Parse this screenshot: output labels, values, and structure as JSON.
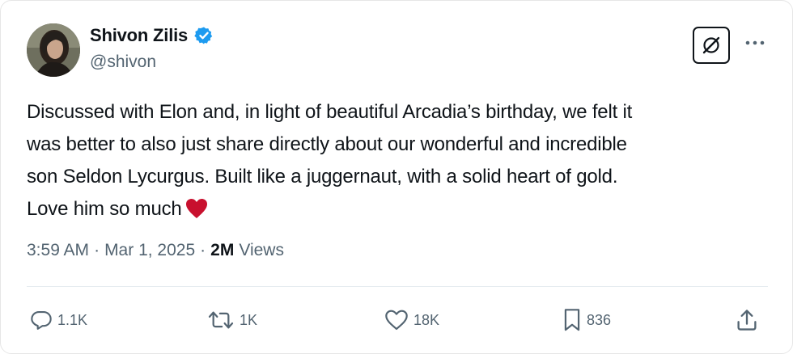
{
  "author": {
    "display_name": "Shivon Zilis",
    "handle": "@shivon",
    "verified": true
  },
  "tweet": {
    "lines": [
      "Discussed with Elon and, in light of beautiful Arcadia’s birthday, we felt it",
      "was better to also just share directly about our wonderful and incredible",
      "son Seldon Lycurgus. Built like a juggernaut, with a solid heart of gold.",
      "Love him so much"
    ],
    "emoji": "red-heart"
  },
  "meta": {
    "time": "3:59 AM",
    "separator": "·",
    "date": "Mar 1, 2025",
    "views_count": "2M",
    "views_label": "Views"
  },
  "actions": {
    "reply_count": "1.1K",
    "repost_count": "1K",
    "like_count": "18K",
    "bookmark_count": "836"
  },
  "icons": {
    "verified": "verified-badge-icon",
    "grok": "grok-icon",
    "more": "more-horizontal-icon",
    "reply": "reply-icon",
    "repost": "repost-icon",
    "like": "heart-icon",
    "bookmark": "bookmark-icon",
    "share": "share-icon"
  },
  "colors": {
    "verified_blue": "#1d9bf0",
    "secondary_text": "#536471",
    "primary_text": "#0f1419",
    "heart_red": "#c8102e"
  }
}
